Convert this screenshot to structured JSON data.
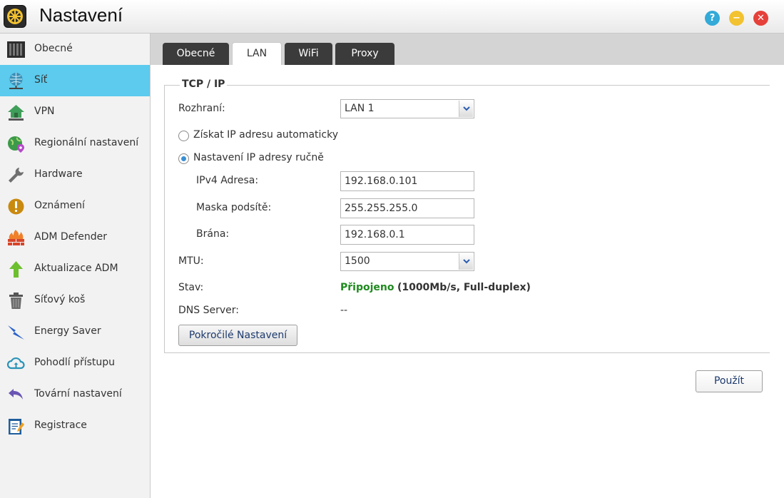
{
  "window": {
    "title": "Nastavení"
  },
  "colors": {
    "accent": "#5ccbed",
    "status_ok": "#1f8a1f"
  },
  "sidebar": {
    "items": [
      {
        "label": "Obecné",
        "icon": "server-icon"
      },
      {
        "label": "Síť",
        "icon": "globe-network-icon"
      },
      {
        "label": "VPN",
        "icon": "vpn-house-icon"
      },
      {
        "label": "Regionální nastavení",
        "icon": "globe-pin-icon"
      },
      {
        "label": "Hardware",
        "icon": "wrench-icon"
      },
      {
        "label": "Oznámení",
        "icon": "alert-icon"
      },
      {
        "label": "ADM Defender",
        "icon": "firewall-icon"
      },
      {
        "label": "Aktualizace ADM",
        "icon": "arrow-up-icon"
      },
      {
        "label": "Síťový koš",
        "icon": "trash-icon"
      },
      {
        "label": "Energy Saver",
        "icon": "lightning-icon"
      },
      {
        "label": "Pohodlí přístupu",
        "icon": "cloud-icon"
      },
      {
        "label": "Tovární nastavení",
        "icon": "undo-arrow-icon"
      },
      {
        "label": "Registrace",
        "icon": "clipboard-icon"
      }
    ],
    "active_index": 1
  },
  "tabs": [
    {
      "label": "Obecné"
    },
    {
      "label": "LAN"
    },
    {
      "label": "WiFi"
    },
    {
      "label": "Proxy"
    }
  ],
  "active_tab": 1,
  "form": {
    "section_title": "TCP / IP",
    "interface_label": "Rozhraní:",
    "interface_value": "LAN 1",
    "radio_auto_label": "Získat IP adresu automaticky",
    "radio_manual_label": "Nastavení IP adresy ručně",
    "ipv4_label": "IPv4 Adresa:",
    "ipv4_value": "192.168.0.101",
    "mask_label": "Maska podsítě:",
    "mask_value": "255.255.255.0",
    "gateway_label": "Brána:",
    "gateway_value": "192.168.0.1",
    "mtu_label": "MTU:",
    "mtu_value": "1500",
    "status_label": "Stav:",
    "status_value": "Připojeno",
    "status_detail": "(1000Mb/s, Full-duplex)",
    "dns_label": "DNS Server:",
    "dns_value": "--",
    "advanced_button": "Pokročilé Nastavení"
  },
  "apply_button": "Použít"
}
